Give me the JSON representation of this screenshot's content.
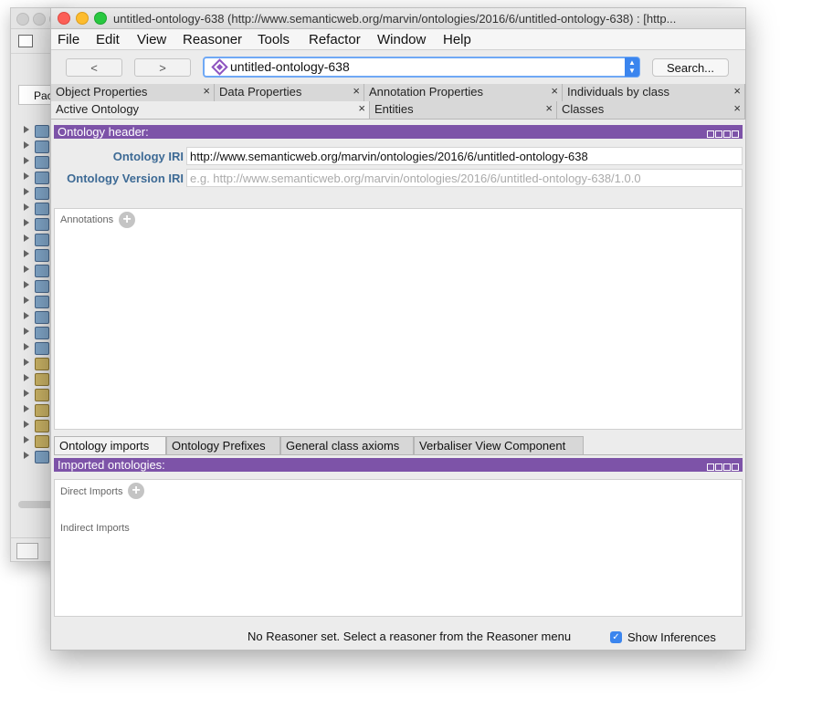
{
  "window": {
    "title": "untitled-ontology-638 (http://www.semanticweb.org/marvin/ontologies/2016/6/untitled-ontology-638)  : [http..."
  },
  "background_window": {
    "tab_label": "Pac"
  },
  "menu": [
    "File",
    "Edit",
    "View",
    "Reasoner",
    "Tools",
    "Refactor",
    "Window",
    "Help"
  ],
  "toolbar": {
    "back_label": "<",
    "forward_label": ">",
    "ontology_selected": "untitled-ontology-638",
    "search_label": "Search..."
  },
  "tabs_row1": [
    {
      "label": "Object Properties",
      "close": "×"
    },
    {
      "label": "Data Properties",
      "close": "×"
    },
    {
      "label": "Annotation Properties",
      "close": "×"
    },
    {
      "label": "Individuals by class",
      "close": "×"
    }
  ],
  "tabs_row2": [
    {
      "label": "Active Ontology",
      "close": "×"
    },
    {
      "label": "Entities",
      "close": "×"
    },
    {
      "label": "Classes",
      "close": "×"
    }
  ],
  "header_panel": {
    "title": "Ontology header:",
    "iri_label": "Ontology IRI",
    "iri_value": "http://www.semanticweb.org/marvin/ontologies/2016/6/untitled-ontology-638",
    "version_label": "Ontology Version IRI",
    "version_placeholder": "e.g. http://www.semanticweb.org/marvin/ontologies/2016/6/untitled-ontology-638/1.0.0",
    "annotations_label": "Annotations"
  },
  "subtabs": [
    "Ontology imports",
    "Ontology Prefixes",
    "General class axioms",
    "Verbaliser View Component"
  ],
  "imports_panel": {
    "title": "Imported ontologies:",
    "direct_label": "Direct Imports",
    "indirect_label": "Indirect Imports"
  },
  "status": {
    "message": "No Reasoner set. Select a reasoner from the Reasoner menu",
    "show_inferences_label": "Show Inferences",
    "show_inferences_checked": true
  },
  "colors": {
    "panel_header": "#7d53a8",
    "label_blue": "#3d6a95",
    "focus_blue": "#3b85ee",
    "traffic_red": "#fc5f57",
    "traffic_yellow": "#fdbc2e",
    "traffic_green": "#28c840"
  }
}
